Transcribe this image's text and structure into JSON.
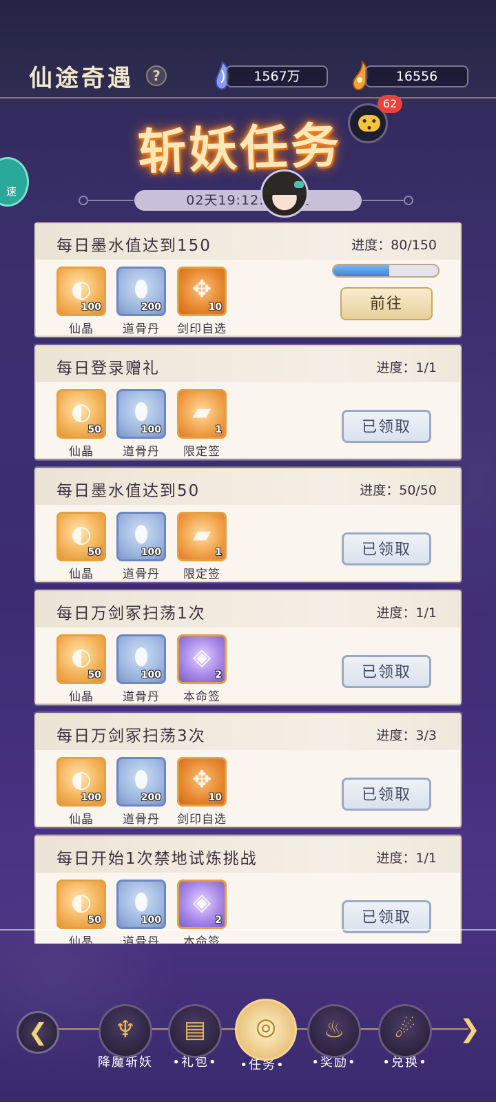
{
  "topbar": {
    "title": "仙途奇遇",
    "help": "?",
    "currency1": "1567万",
    "currency2": "16556"
  },
  "header": {
    "banner": "斩妖任务",
    "countdown": "02天19:12:33结束",
    "chat_badge": "62",
    "speed_label": "速"
  },
  "tasks": [
    {
      "name": "每日墨水值达到150",
      "progress_label": "进度：80/150",
      "progress": 0.533,
      "button": "前往",
      "state": "go",
      "rewards": [
        {
          "icon": "xianjing-icon",
          "label": "仙晶",
          "count": "100"
        },
        {
          "icon": "daogudan-icon",
          "label": "道骨丹",
          "count": "200"
        },
        {
          "icon": "jianyin-icon",
          "label": "剑印自选",
          "count": "10"
        }
      ]
    },
    {
      "name": "每日登录赠礼",
      "progress_label": "进度：1/1",
      "button": "已领取",
      "state": "done",
      "rewards": [
        {
          "icon": "xianjing-icon",
          "label": "仙晶",
          "count": "50"
        },
        {
          "icon": "daogudan-icon",
          "label": "道骨丹",
          "count": "100"
        },
        {
          "icon": "xiandingqian-icon",
          "label": "限定签",
          "count": "1"
        }
      ]
    },
    {
      "name": "每日墨水值达到50",
      "progress_label": "进度：50/50",
      "button": "已领取",
      "state": "done",
      "rewards": [
        {
          "icon": "xianjing-icon",
          "label": "仙晶",
          "count": "50"
        },
        {
          "icon": "daogudan-icon",
          "label": "道骨丹",
          "count": "100"
        },
        {
          "icon": "xiandingqian-icon",
          "label": "限定签",
          "count": "1"
        }
      ]
    },
    {
      "name": "每日万剑冢扫荡1次",
      "progress_label": "进度：1/1",
      "button": "已领取",
      "state": "done",
      "rewards": [
        {
          "icon": "xianjing-icon",
          "label": "仙晶",
          "count": "50"
        },
        {
          "icon": "daogudan-icon",
          "label": "道骨丹",
          "count": "100"
        },
        {
          "icon": "benmingqian-icon",
          "label": "本命签",
          "count": "2"
        }
      ]
    },
    {
      "name": "每日万剑冢扫荡3次",
      "progress_label": "进度：3/3",
      "button": "已领取",
      "state": "done",
      "rewards": [
        {
          "icon": "xianjing-icon",
          "label": "仙晶",
          "count": "100"
        },
        {
          "icon": "daogudan-icon",
          "label": "道骨丹",
          "count": "200"
        },
        {
          "icon": "jianyin-icon",
          "label": "剑印自选",
          "count": "10"
        }
      ]
    },
    {
      "name": "每日开始1次禁地试炼挑战",
      "progress_label": "进度：1/1",
      "button": "已领取",
      "state": "done",
      "rewards": [
        {
          "icon": "xianjing-icon",
          "label": "仙晶",
          "count": "50"
        },
        {
          "icon": "daogudan-icon",
          "label": "道骨丹",
          "count": "100"
        },
        {
          "icon": "benmingqian-icon",
          "label": "本命签",
          "count": "2"
        }
      ]
    }
  ],
  "nav": [
    {
      "label": "降魔斩妖",
      "icon": "demon-icon",
      "active": false
    },
    {
      "label": "•礼包•",
      "icon": "gift-icon",
      "active": false
    },
    {
      "label": "•任务•",
      "icon": "task-icon",
      "active": true
    },
    {
      "label": "•奖励•",
      "icon": "reward-icon",
      "active": false
    },
    {
      "label": "•兑换•",
      "icon": "exchange-icon",
      "active": false
    }
  ]
}
